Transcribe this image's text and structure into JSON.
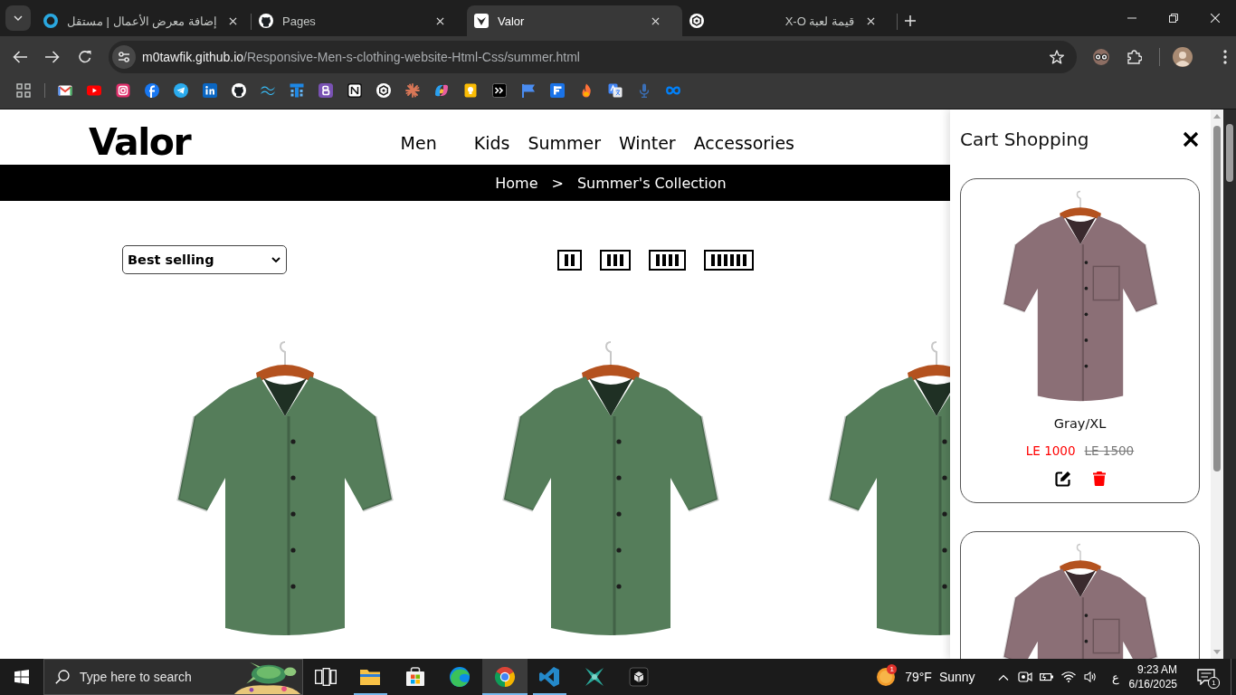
{
  "browser": {
    "tabs": [
      {
        "title": "إضافة معرض الأعمال | مستقل",
        "selected": false
      },
      {
        "title": "Pages",
        "selected": false
      },
      {
        "title": "Valor",
        "selected": true
      },
      {
        "title": "قيمة لعبة X-O",
        "selected": false
      }
    ],
    "address_bar": {
      "host": "m0tawfik.github.io",
      "path": "/Responsive-Men-s-clothing-website-Html-Css/summer.html"
    }
  },
  "page": {
    "logo": "Valor",
    "nav": [
      "Men",
      "Kids",
      "Summer",
      "Winter",
      "Accessories"
    ],
    "breadcrumb": {
      "items": [
        "Home",
        "Summer's Collection"
      ],
      "separator": ">"
    },
    "sort_select": {
      "value": "Best selling"
    },
    "layout_buttons": [
      {
        "kind": "two"
      },
      {
        "kind": "three"
      },
      {
        "kind": "four"
      },
      {
        "kind": "six"
      }
    ],
    "products": [
      {
        "kind": "shirt"
      },
      {
        "kind": "shirt"
      },
      {
        "kind": "shirt"
      }
    ]
  },
  "cart": {
    "title": "Cart Shopping",
    "items": [
      {
        "kind": "shirt",
        "variant": "Gray/XL",
        "price": "LE 1000",
        "old_price": "LE 1500"
      },
      {
        "kind": "shirt"
      }
    ]
  },
  "taskbar": {
    "search": {
      "placeholder": "Type here to search"
    },
    "apps": [
      {
        "selected": false,
        "running": true
      },
      {
        "selected": false,
        "running": false
      },
      {
        "selected": false,
        "running": false
      },
      {
        "selected": true,
        "running": true
      },
      {
        "selected": false,
        "running": true
      },
      {
        "selected": false,
        "running": false
      },
      {
        "selected": false,
        "running": false
      }
    ],
    "weather": {
      "temperature": "79°F",
      "condition": "Sunny",
      "badge": "1"
    },
    "language": "ع",
    "time": "9:23 AM",
    "date": "6/16/2025",
    "notifications": "1"
  }
}
